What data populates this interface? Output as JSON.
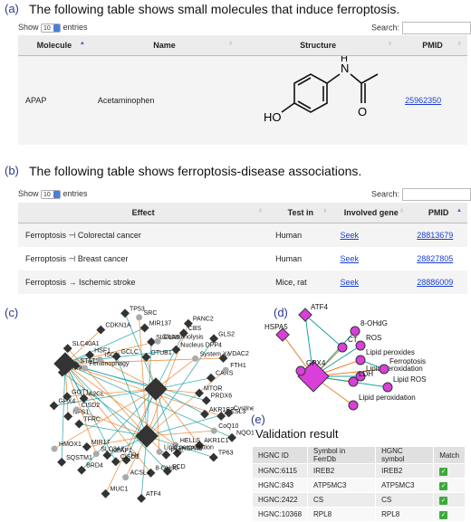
{
  "panel_a": {
    "label": "(a)",
    "heading": "The following table shows small molecules that induce ferroptosis.",
    "show_label": "Show",
    "entries_value": "10",
    "entries_label": "entries",
    "search_label": "Search:",
    "columns": [
      "Molecule",
      "Name",
      "Structure",
      "PMID"
    ],
    "rows": [
      {
        "molecule": "APAP",
        "name": "Acetaminophen",
        "structure_labels": {
          "nh": "N",
          "h": "H",
          "ho": "HO",
          "o": "O"
        },
        "pmid": "25962350"
      }
    ]
  },
  "panel_b": {
    "label": "(b)",
    "heading": "The following table shows ferroptosis-disease associations.",
    "show_label": "Show",
    "entries_value": "10",
    "entries_label": "entries",
    "search_label": "Search:",
    "columns": [
      "Effect",
      "Test in",
      "Involved gene",
      "PMID"
    ],
    "rows": [
      {
        "effect": "Ferroptosis ⊣ Colorectal cancer",
        "test_in": "Human",
        "gene": "Seek",
        "pmid": "28813679"
      },
      {
        "effect": "Ferroptosis ⊣ Breast cancer",
        "test_in": "Human",
        "gene": "Seek",
        "pmid": "28827805"
      },
      {
        "effect": "Ferroptosis → Ischemic stroke",
        "test_in": "Mice, rat",
        "gene": "Seek",
        "pmid": "28886009"
      }
    ]
  },
  "panel_c": {
    "label": "(c)",
    "node_labels": [
      "ACSL3",
      "AKR1C2",
      "CoQ10",
      "NQO1",
      "AKR1C1",
      "TP63",
      "HELLS",
      "HSPA5",
      "PML",
      "SCD",
      "Lipid peroxidation",
      "ATF4",
      "8-OHdG",
      "FH",
      "ACSL4",
      "CISD1",
      "MUC1",
      "KEAP1",
      "SLC3A2",
      "BRD4",
      "MIR17",
      "SQSTM1",
      "HMOX1",
      "TFRC",
      "NFS1",
      "GPX4",
      "CISD2",
      "A2CL",
      "GOT1",
      "MIR9",
      "Fenitinophagy",
      "STAT3",
      "SLC40A1",
      "HSF1",
      "ISCU",
      "GCLC",
      "CDKN1A",
      "TP53",
      "SRC",
      "MIR137",
      "OTUB1",
      "SLC1A5",
      "Glutaminolysis",
      "CBS",
      "PANC2",
      "Nucleus DPP4",
      "System Xc",
      "GLS2",
      "VDAC2",
      "CARS",
      "FTH1",
      "PRDX6",
      "MTOR",
      "Cystine"
    ]
  },
  "panel_d": {
    "label": "(d)",
    "node_labels": [
      "ATF4",
      "HSPA5",
      "8-OHdG",
      "CT",
      "ROS",
      "Lipid peroxides",
      "Lipid peroxidation",
      "Ferroptosis",
      "GPX4",
      "LDH",
      "Lipid ROS",
      "Lipid peroxidation"
    ]
  },
  "panel_e": {
    "label": "(e)",
    "title": "Validation result",
    "columns": [
      "HGNC ID",
      "Symbol in FerrDb",
      "HGNC symbol",
      "Match"
    ],
    "rows": [
      {
        "id": "HGNC:6115",
        "ferrdb": "IREB2",
        "hgnc": "IREB2",
        "match": "✓"
      },
      {
        "id": "HGNC:843",
        "ferrdb": "ATP5MC3",
        "hgnc": "ATP5MC3",
        "match": "✓"
      },
      {
        "id": "HGNC:2422",
        "ferrdb": "CS",
        "hgnc": "CS",
        "match": "✓"
      },
      {
        "id": "HGNC:10368",
        "ferrdb": "RPL8",
        "hgnc": "RPL8",
        "match": "✓"
      }
    ]
  },
  "colors": {
    "accent": "#1a3fd0",
    "node_dark": "#333333",
    "node_gray": "#aaaaaa",
    "edge_teal": "#1aa3a3",
    "edge_orange": "#e8822a",
    "node_magenta": "#d93fd9"
  }
}
